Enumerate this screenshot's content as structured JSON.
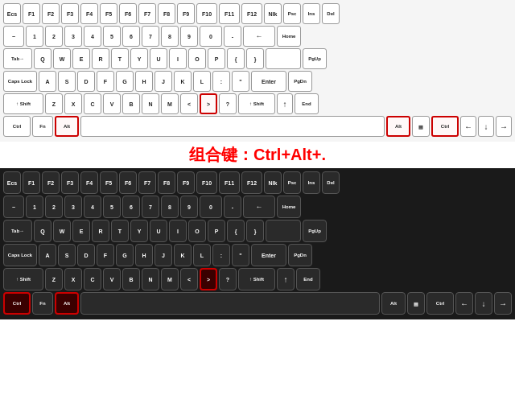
{
  "combo_label": "组合键：Ctrl+Alt+.",
  "white_keyboard": {
    "rows": [
      [
        "Ecs",
        "F1",
        "F2",
        "F3",
        "F4",
        "F5",
        "F6",
        "F7",
        "F8",
        "F9",
        "F10",
        "F11",
        "F12",
        "Nlk",
        "Psc",
        "Ins",
        "Del"
      ],
      [
        "~",
        "1",
        "2",
        "3",
        "4",
        "5",
        "6",
        "7",
        "8",
        "9",
        "0",
        "-",
        "←",
        "Home"
      ],
      [
        "Tab→",
        "Q",
        "W",
        "E",
        "R",
        "T",
        "Y",
        "U",
        "I",
        "O",
        "P",
        "{",
        "}",
        "PgUp"
      ],
      [
        "Caps Lock",
        "A",
        "S",
        "D",
        "F",
        "G",
        "H",
        "J",
        "K",
        "L",
        ":",
        "\"",
        "Enter",
        "PgDn"
      ],
      [
        "↑ Shift",
        "Z",
        "X",
        "C",
        "V",
        "B",
        "N",
        "M",
        "<",
        ">",
        "?",
        "↑ Shift",
        "↑",
        "End"
      ],
      [
        "Ctrl",
        "Fn",
        "Alt",
        "Alt",
        "▤",
        "Ctrl",
        "←",
        "↓",
        "→"
      ]
    ]
  },
  "black_keyboard": {
    "rows": [
      [
        "Ecs",
        "F1",
        "F2",
        "F3",
        "F4",
        "F5",
        "F6",
        "F7",
        "F8",
        "F9",
        "F10",
        "F11",
        "F12",
        "Nlk",
        "Psc",
        "Ins",
        "Del"
      ],
      [
        "~",
        "1",
        "2",
        "3",
        "4",
        "5",
        "6",
        "7",
        "8",
        "9",
        "0",
        "-",
        "←",
        "Home"
      ],
      [
        "Tab→",
        "Q",
        "W",
        "E",
        "R",
        "T",
        "Y",
        "U",
        "I",
        "O",
        "P",
        "{",
        "}",
        "PgUp"
      ],
      [
        "Caps Lock",
        "A",
        "S",
        "D",
        "F",
        "G",
        "H",
        "J",
        "K",
        "L",
        ":",
        "\"",
        "Enter",
        "PgDn"
      ],
      [
        "↑ Shift",
        "Z",
        "X",
        "C",
        "V",
        "B",
        "N",
        "M",
        "<",
        ">",
        "?",
        "↑ Shift",
        "↑",
        "End"
      ],
      [
        "Ctrl",
        "Fn",
        "Alt",
        "Alt",
        "▤",
        "Ctrl",
        "←",
        "↓",
        "→"
      ]
    ]
  }
}
